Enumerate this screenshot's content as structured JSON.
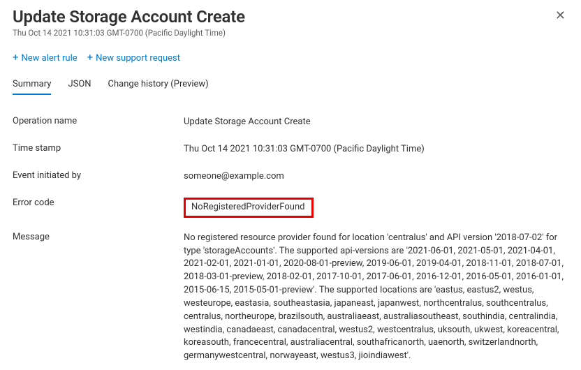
{
  "header": {
    "title": "Update Storage Account Create",
    "timestamp": "Thu Oct 14 2021 10:31:03 GMT-0700 (Pacific Daylight Time)"
  },
  "toolbar": {
    "new_alert": "New alert rule",
    "new_support": "New support request"
  },
  "tabs": {
    "summary": "Summary",
    "json": "JSON",
    "change_history": "Change history (Preview)"
  },
  "details": {
    "operation_name": {
      "label": "Operation name",
      "value": "Update Storage Account Create"
    },
    "time_stamp": {
      "label": "Time stamp",
      "value": "Thu Oct 14 2021 10:31:03 GMT-0700 (Pacific Daylight Time)"
    },
    "event_initiated_by": {
      "label": "Event initiated by",
      "value": "someone@example.com"
    },
    "error_code": {
      "label": "Error code",
      "value": "NoRegisteredProviderFound"
    },
    "message": {
      "label": "Message",
      "value": "No registered resource provider found for location 'centralus' and API version '2018-07-02' for type 'storageAccounts'. The supported api-versions are '2021-06-01, 2021-05-01, 2021-04-01, 2021-02-01, 2021-01-01, 2020-08-01-preview, 2019-06-01, 2019-04-01, 2018-11-01, 2018-07-01, 2018-03-01-preview, 2018-02-01, 2017-10-01, 2017-06-01, 2016-12-01, 2016-05-01, 2016-01-01, 2015-06-15, 2015-05-01-preview'. The supported locations are 'eastus, eastus2, westus, westeurope, eastasia, southeastasia, japaneast, japanwest, northcentralus, southcentralus, centralus, northeurope, brazilsouth, australiaeast, australiasoutheast, southindia, centralindia, westindia, canadaeast, canadacentral, westus2, westcentralus, uksouth, ukwest, koreacentral, koreasouth, francecentral, australiacentral, southafricanorth, uaenorth, switzerlandnorth, germanywestcentral, norwayeast, westus3, jioindiawest'."
    }
  }
}
